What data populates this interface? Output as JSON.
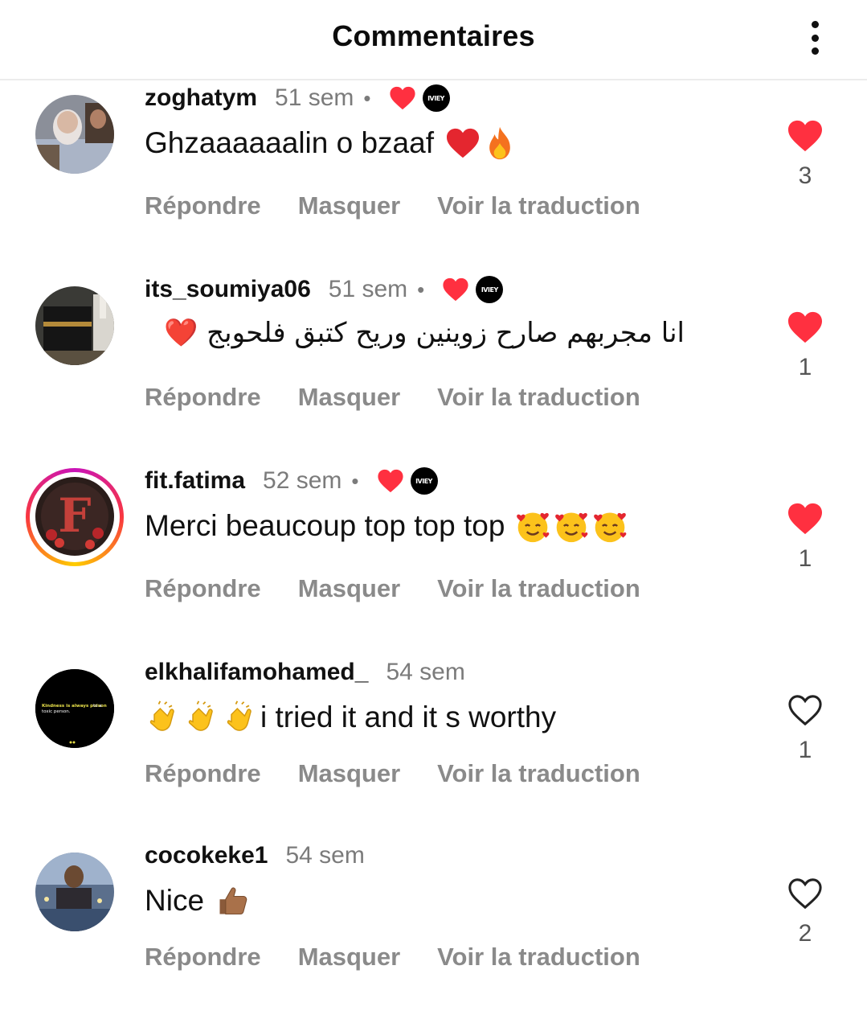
{
  "header": {
    "title": "Commentaires"
  },
  "comments": [
    {
      "username": "zoghatym",
      "time": "51 sem",
      "creator_badge": "IVIEY",
      "text": "Ghzaaaaaalin o bzaaf",
      "emojis": [
        "red-heart",
        "fire"
      ],
      "actions": {
        "reply": "Répondre",
        "hide": "Masquer",
        "translate": "Voir la traduction"
      },
      "likes": "3"
    },
    {
      "username": "its_soumiya06",
      "time": "51 sem",
      "creator_badge": "IVIEY",
      "text": "انا مجربهم صارح زوينين وريح كتبق فلحوبج ❤️",
      "emojis": [],
      "actions": {
        "reply": "Répondre",
        "hide": "Masquer",
        "translate": "Voir la traduction"
      },
      "likes": "1"
    },
    {
      "username": "fit.fatima",
      "time": "52 sem",
      "creator_badge": "IVIEY",
      "text": "Merci beaucoup top top top",
      "emojis": [
        "smiling-face-with-hearts",
        "smiling-face-with-hearts",
        "smiling-face-with-hearts"
      ],
      "actions": {
        "reply": "Répondre",
        "hide": "Masquer",
        "translate": "Voir la traduction"
      },
      "likes": "1"
    },
    {
      "username": "elkhalifamohamed_",
      "time": "54 sem",
      "text": "i tried it and it s worthy",
      "emojis": [
        "clapping-hands",
        "clapping-hands",
        "clapping-hands"
      ],
      "avatar_text": "Kindness is always poison to a toxic person.",
      "actions": {
        "reply": "Répondre",
        "hide": "Masquer",
        "translate": "Voir la traduction"
      },
      "likes": "1"
    },
    {
      "username": "cocokeke1",
      "time": "54 sem",
      "text": "Nice",
      "emojis": [
        "thumbs-up"
      ],
      "actions": {
        "reply": "Répondre",
        "hide": "Masquer",
        "translate": "Voir la traduction"
      },
      "likes": "2"
    }
  ],
  "colors": {
    "like_red": "#ff3040",
    "muted": "#8a8a8a",
    "time": "#7b7b7b"
  }
}
